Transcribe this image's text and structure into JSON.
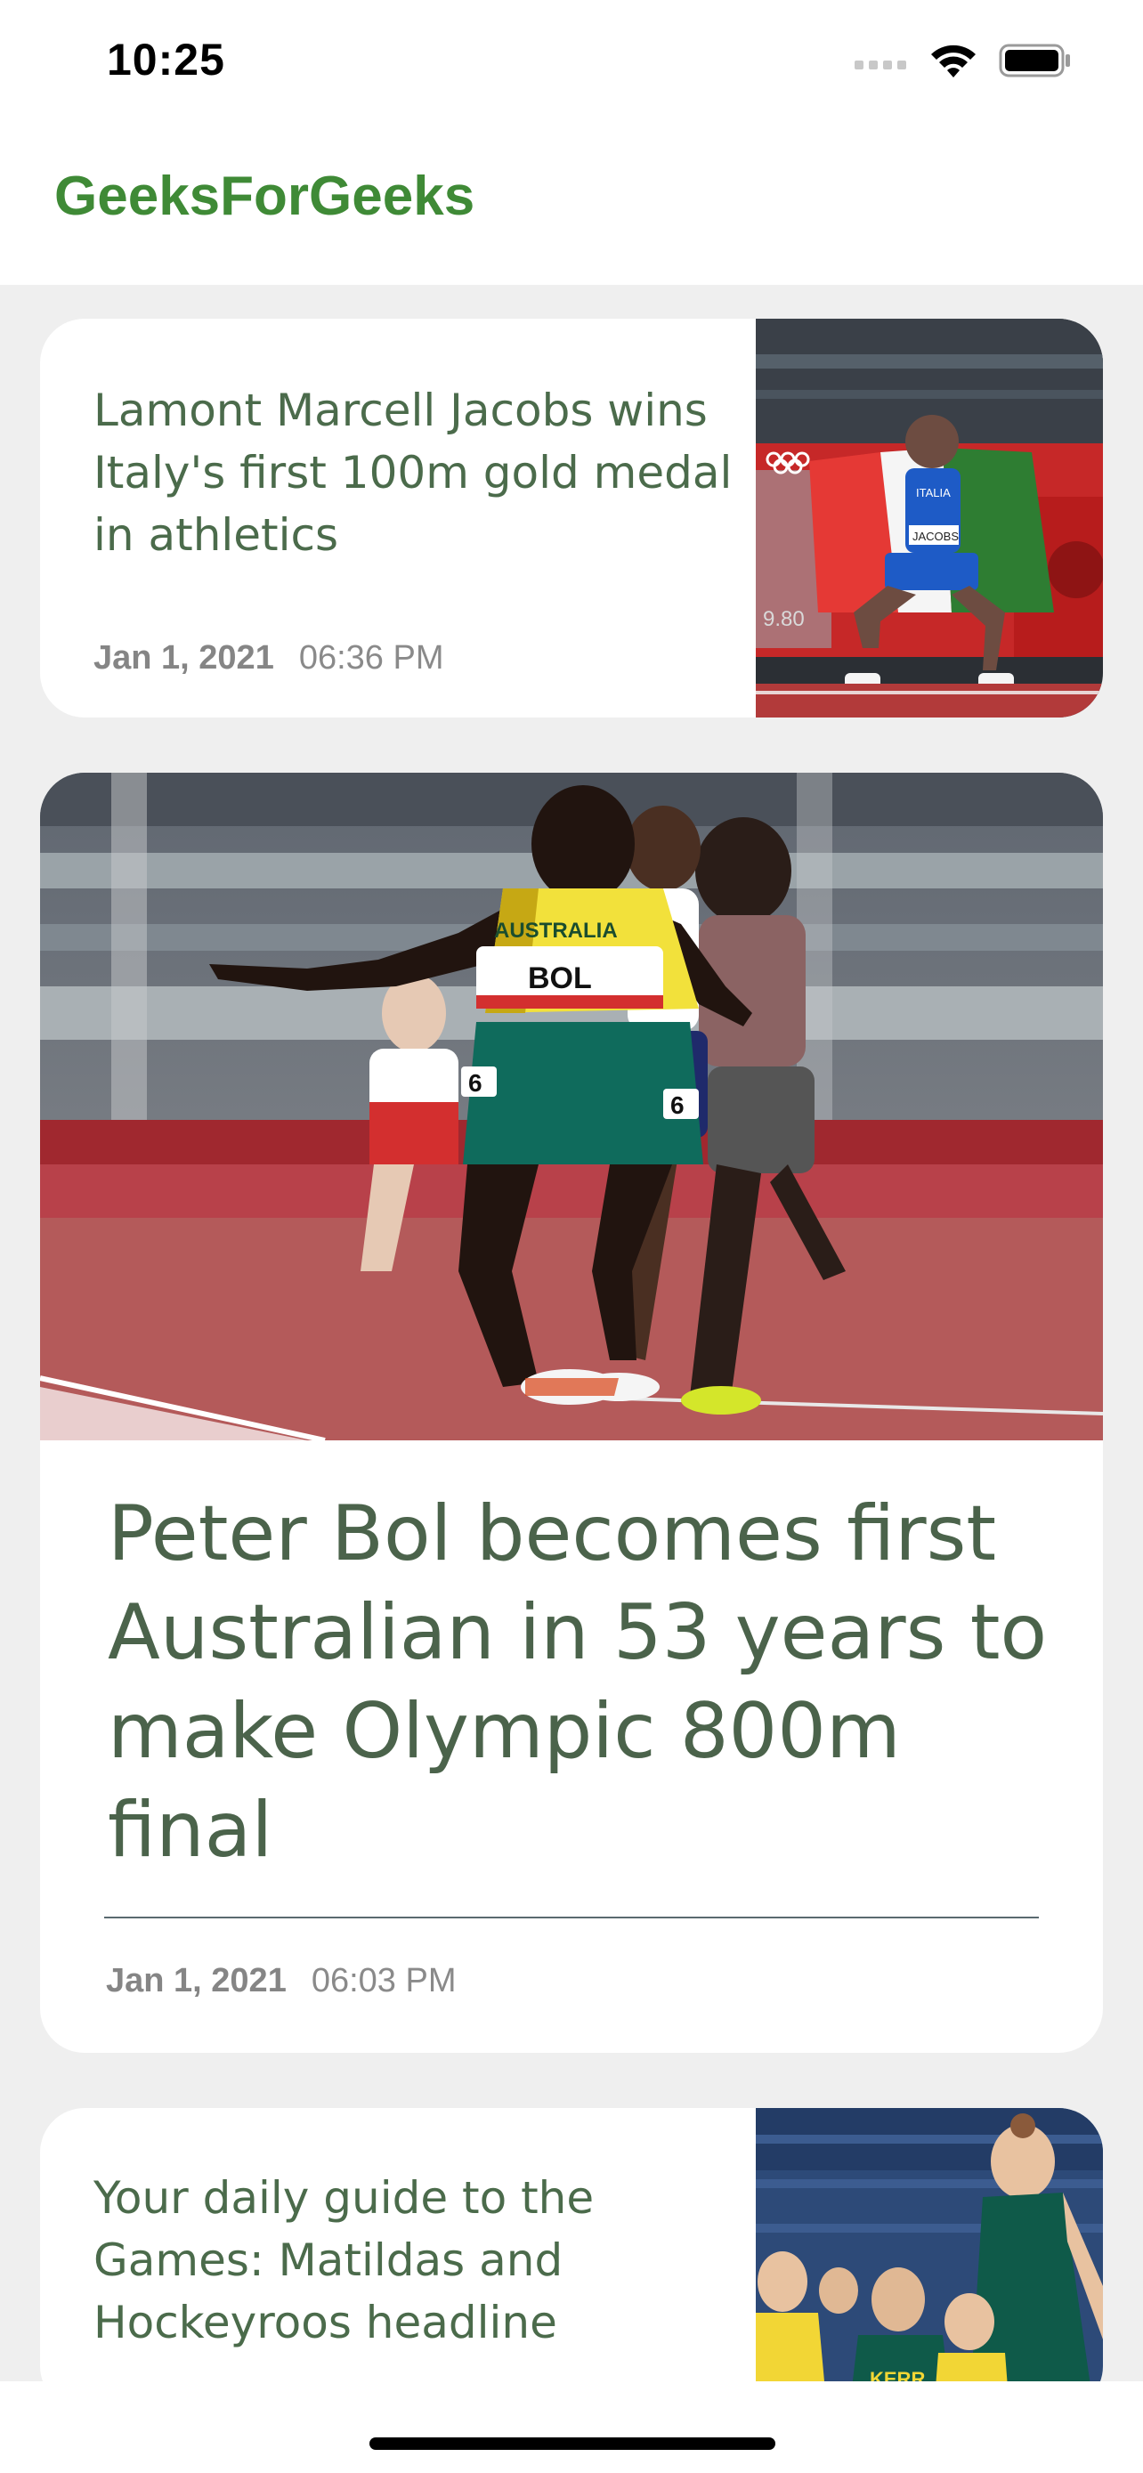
{
  "status": {
    "time": "10:25"
  },
  "app": {
    "title": "GeeksForGeeks"
  },
  "articles": [
    {
      "headline": "Lamont Marcell Jacobs wins Italy's first 100m gold medal in athletics",
      "date": "Jan 1, 2021",
      "time": "06:36 PM",
      "layout": "compact"
    },
    {
      "headline": "Peter Bol becomes first Australian in 53 years to make Olympic 800m final",
      "date": "Jan 1, 2021",
      "time": "06:03 PM",
      "layout": "featured"
    },
    {
      "headline": "Your daily guide to the Games: Matildas and Hockeyroos headline",
      "layout": "compact"
    }
  ],
  "photo_text": {
    "bib_jacobs": "JACOBS",
    "shirt_italia": "ITALIA",
    "clock": "9.80",
    "bib_bol": "BOL",
    "shirt_australia": "AUSTRALIA",
    "bib_number": "6",
    "shirt_kerr": "KERR"
  },
  "colors": {
    "brand": "#3f8a36",
    "headline": "#4b6b4b",
    "background": "#efefef",
    "card": "#ffffff"
  },
  "icons": [
    "signal-icon",
    "wifi-icon",
    "battery-icon"
  ]
}
